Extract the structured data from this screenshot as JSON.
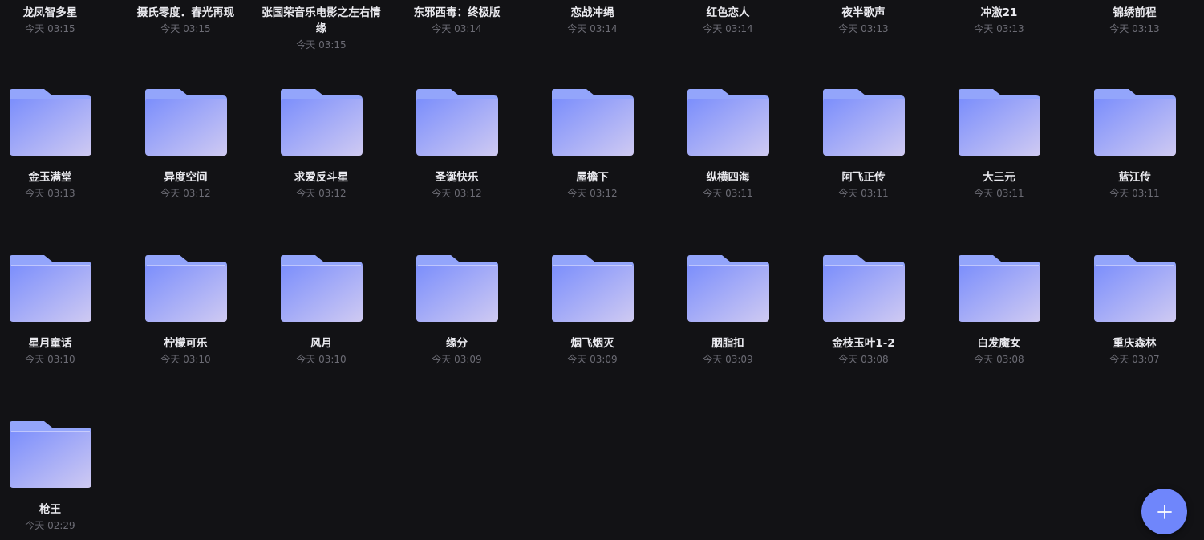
{
  "colors": {
    "background": "#121215",
    "folder_back": "#93a5fb",
    "folder_front_start": "#7b8efc",
    "folder_front_end": "#cfcaf2",
    "fab": "#6f86fb"
  },
  "top_row": [
    {
      "name": "龙凤智多星",
      "time": "今天 03:15"
    },
    {
      "name": "摄氏零度．春光再现",
      "time": "今天 03:15"
    },
    {
      "name": "张国荣音乐电影之左右情缘",
      "time": "今天 03:15"
    },
    {
      "name": "东邪西毒：终极版",
      "time": "今天 03:14"
    },
    {
      "name": "恋战冲绳",
      "time": "今天 03:14"
    },
    {
      "name": "红色恋人",
      "time": "今天 03:14"
    },
    {
      "name": "夜半歌声",
      "time": "今天 03:13"
    },
    {
      "name": "冲激21",
      "time": "今天 03:13"
    },
    {
      "name": "锦绣前程",
      "time": "今天 03:13"
    }
  ],
  "folders": [
    {
      "name": "金玉满堂",
      "time": "今天 03:13"
    },
    {
      "name": "异度空间",
      "time": "今天 03:12"
    },
    {
      "name": "求爱反斗星",
      "time": "今天 03:12"
    },
    {
      "name": "圣诞快乐",
      "time": "今天 03:12"
    },
    {
      "name": "屋檐下",
      "time": "今天 03:12"
    },
    {
      "name": "纵横四海",
      "time": "今天 03:11"
    },
    {
      "name": "阿飞正传",
      "time": "今天 03:11"
    },
    {
      "name": "大三元",
      "time": "今天 03:11"
    },
    {
      "name": "蓝江传",
      "time": "今天 03:11"
    },
    {
      "name": "星月童话",
      "time": "今天 03:10"
    },
    {
      "name": "柠檬可乐",
      "time": "今天 03:10"
    },
    {
      "name": "风月",
      "time": "今天 03:10"
    },
    {
      "name": "缘分",
      "time": "今天 03:09"
    },
    {
      "name": "烟飞烟灭",
      "time": "今天 03:09"
    },
    {
      "name": "胭脂扣",
      "time": "今天 03:09"
    },
    {
      "name": "金枝玉叶1-2",
      "time": "今天 03:08"
    },
    {
      "name": "白发魔女",
      "time": "今天 03:08"
    },
    {
      "name": "重庆森林",
      "time": "今天 03:07"
    },
    {
      "name": "枪王",
      "time": "今天 02:29"
    }
  ],
  "fab": {
    "icon": "plus-icon"
  }
}
